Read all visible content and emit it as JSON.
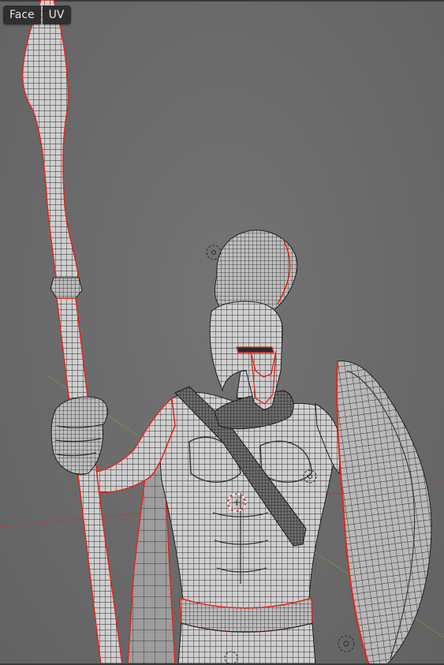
{
  "header_menu": {
    "select_mode_label": "Face",
    "uv_menu_label": "UV"
  },
  "viewport": {
    "background_color": "#6b6b6b",
    "seam_color": "#e0261a",
    "wire_color": "#2a2a2a",
    "mesh_color": "#c8c8c8",
    "x_axis_color": "#b04040",
    "y_axis_color": "#6f9a3a",
    "model_icon": "spartan-warrior-mesh",
    "empty_icon": "empty-object-icon",
    "cursor_icon": "3d-cursor-icon"
  }
}
